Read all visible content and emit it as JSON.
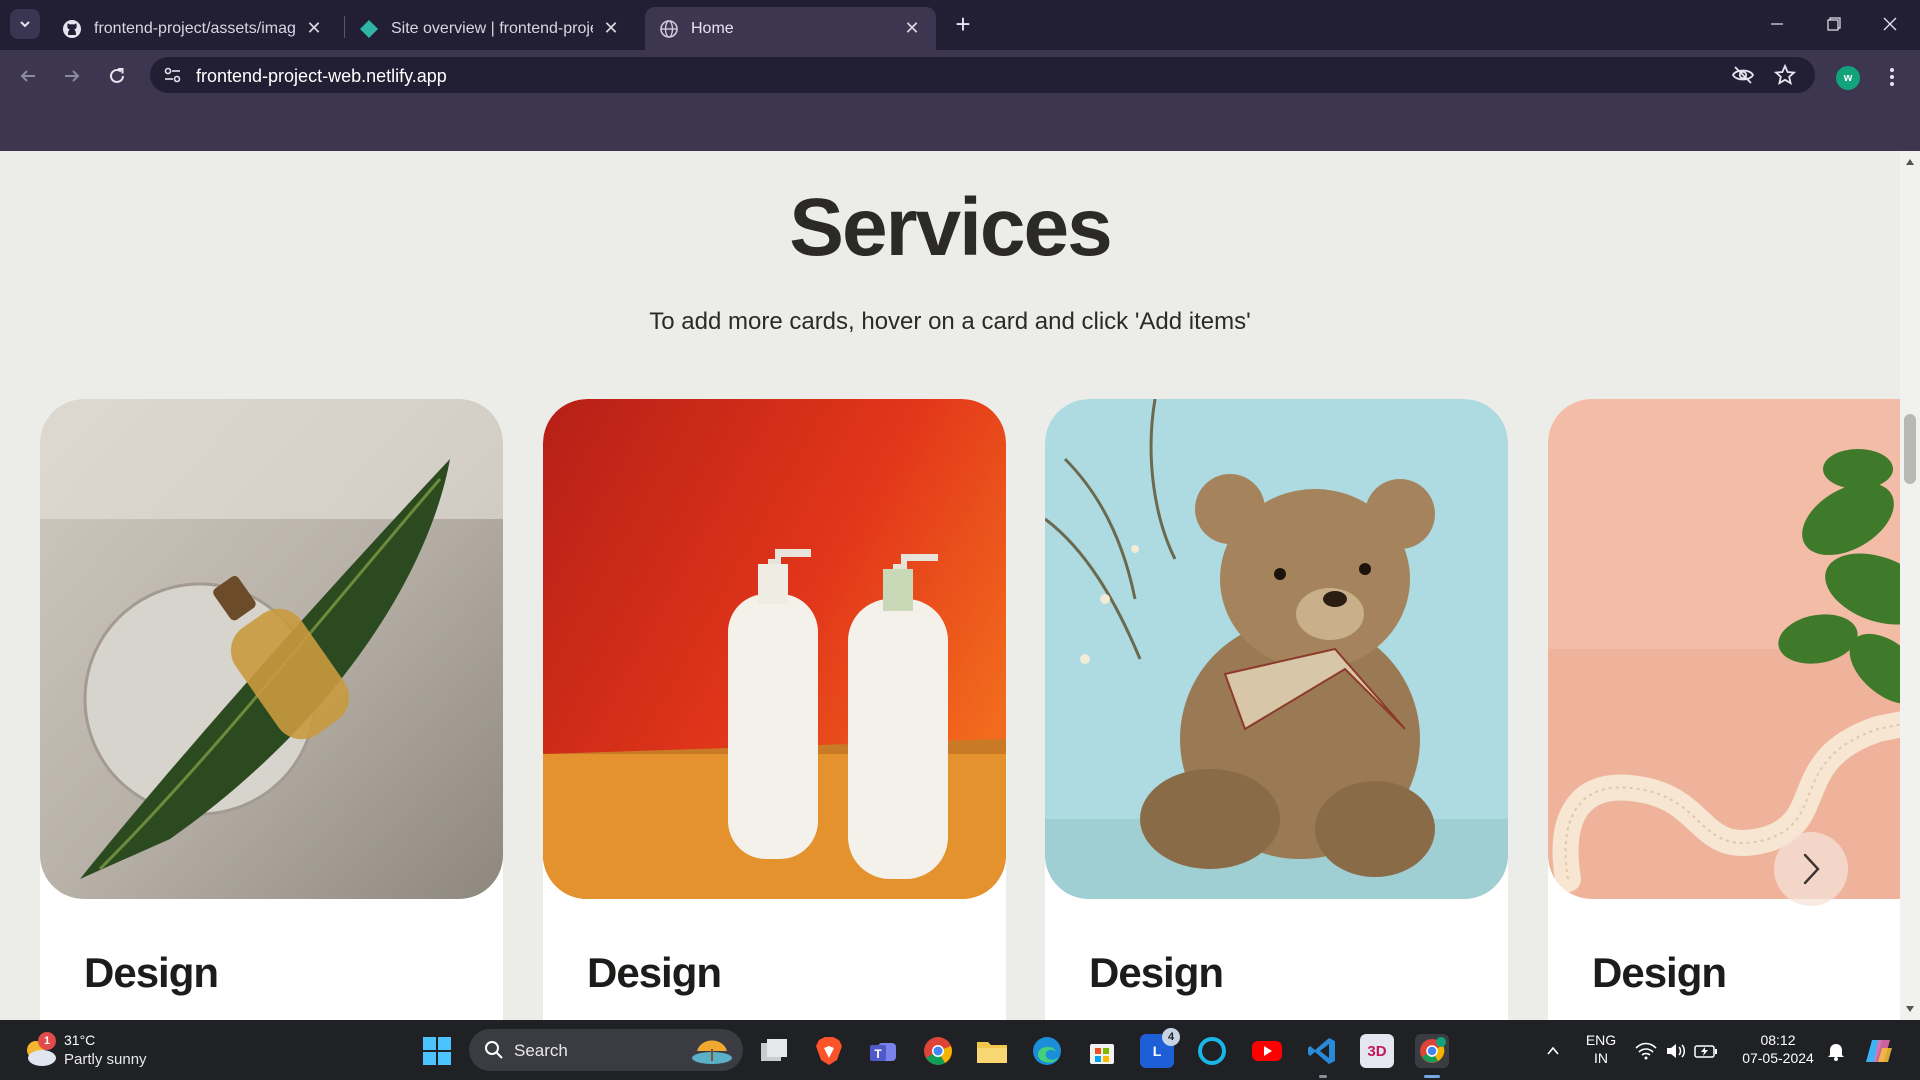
{
  "browser": {
    "tabs": [
      {
        "title": "frontend-project/assets/images",
        "favicon": "github-icon"
      },
      {
        "title": "Site overview | frontend-project",
        "favicon": "netlify-icon"
      },
      {
        "title": "Home",
        "favicon": "globe-icon",
        "active": true
      }
    ],
    "url": "frontend-project-web.netlify.app",
    "profile_initial": "w",
    "accent_color": "#3c3651",
    "dark_color": "#221e33"
  },
  "page": {
    "title": "Services",
    "subtitle": "To add more cards, hover on a card and click 'Add items'",
    "background": "#ecede8",
    "cards": [
      {
        "heading": "Design",
        "image": "perfume-bottle-on-leaf"
      },
      {
        "heading": "Design",
        "image": "lotion-bottles-on-orange"
      },
      {
        "heading": "Design",
        "image": "teddy-bear-on-blue"
      },
      {
        "heading": "Design",
        "image": "plant-and-ribbon-on-pink"
      }
    ]
  },
  "taskbar": {
    "weather_temp": "31°C",
    "weather_desc": "Partly sunny",
    "weather_badge": "1",
    "search_label": "Search",
    "lang_line1": "ENG",
    "lang_line2": "IN",
    "time": "08:12",
    "date": "07-05-2024",
    "app_badge": "4",
    "app_3d_label": "3D"
  }
}
